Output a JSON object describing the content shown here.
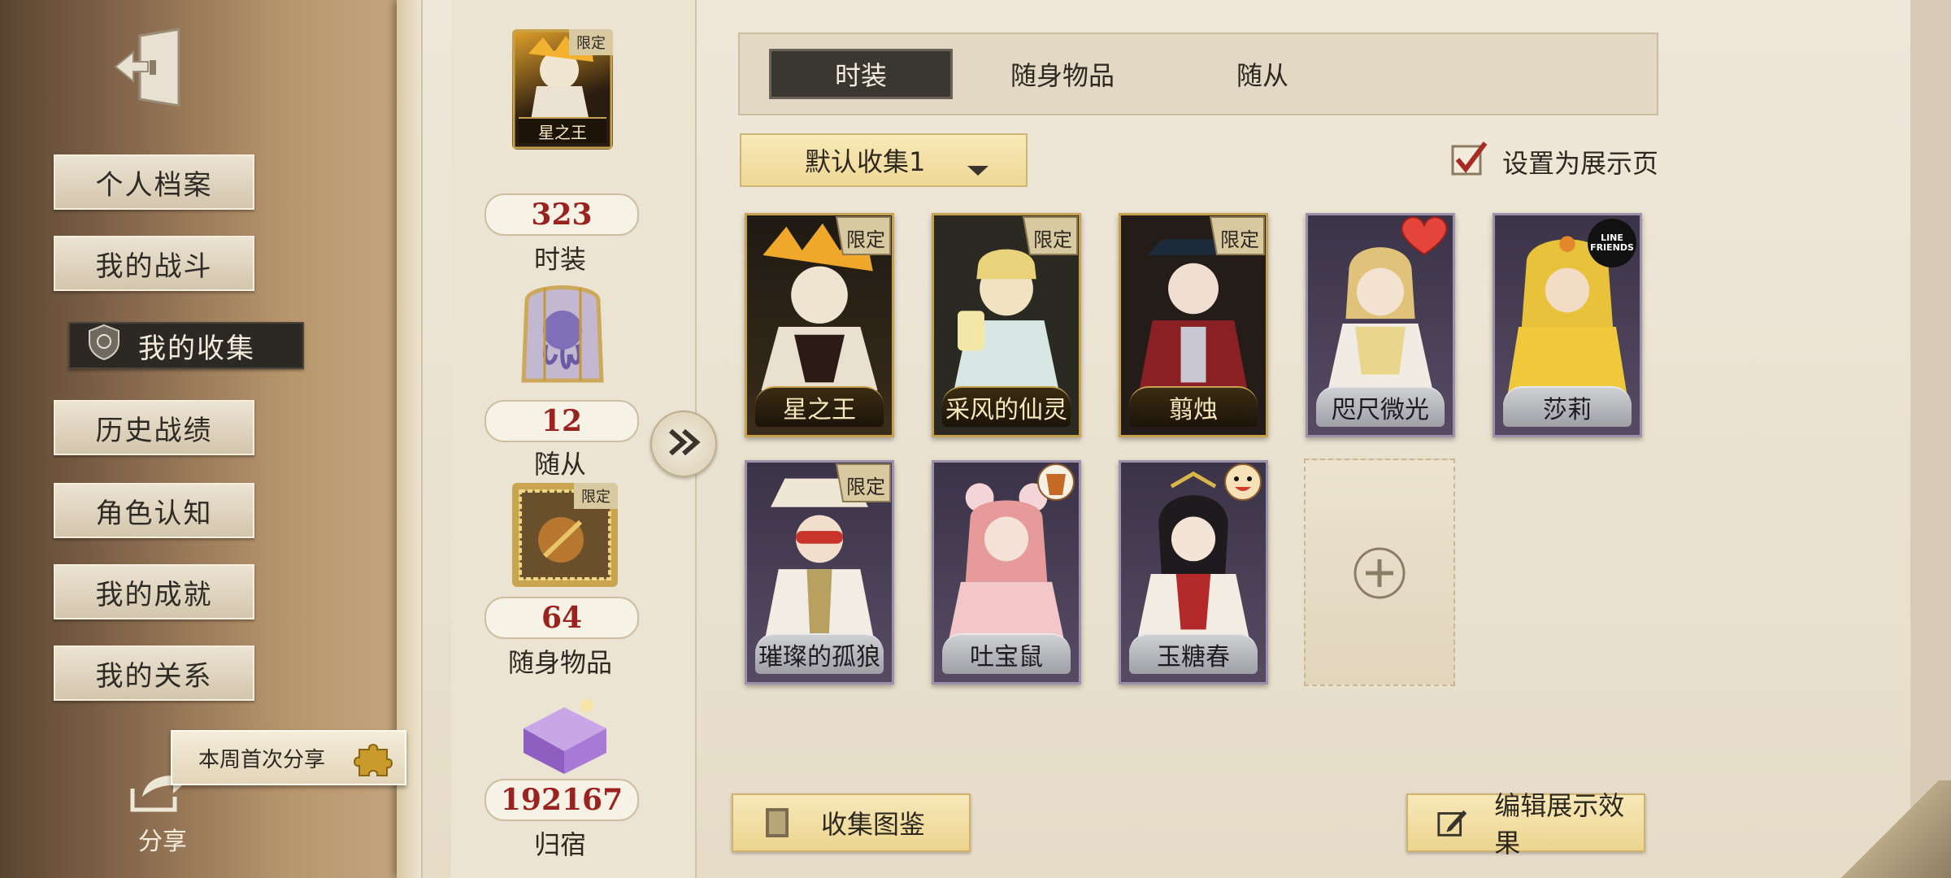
{
  "sidebar": {
    "items": [
      {
        "label": "个人档案"
      },
      {
        "label": "我的战斗"
      },
      {
        "label": "我的收集"
      },
      {
        "label": "历史战绩"
      },
      {
        "label": "角色认知"
      },
      {
        "label": "我的成就"
      },
      {
        "label": "我的关系"
      }
    ],
    "active_item": "我的收集",
    "share_banner": "本周首次分享",
    "share_label": "分享"
  },
  "summary": {
    "costume": {
      "thumb_label": "星之王",
      "badge": "限定",
      "count": "323",
      "label": "时装"
    },
    "pet": {
      "count": "12",
      "label": "随从"
    },
    "accessory": {
      "badge": "限定",
      "count": "64",
      "label": "随身物品"
    },
    "home": {
      "count": "192167",
      "label": "归宿"
    }
  },
  "tabs": [
    {
      "label": "时装",
      "active": true
    },
    {
      "label": "随身物品",
      "active": false
    },
    {
      "label": "随从",
      "active": false
    }
  ],
  "dropdown": {
    "selected": "默认收集1"
  },
  "showcase": {
    "label": "设置为展示页",
    "checked": true
  },
  "cards": [
    {
      "name": "星之王",
      "badge": "限定",
      "frame": "gold"
    },
    {
      "name": "采风的仙灵",
      "badge": "限定",
      "frame": "gold"
    },
    {
      "name": "翦烛",
      "badge": "限定",
      "frame": "gold"
    },
    {
      "name": "咫尺微光",
      "badge": "heart",
      "frame": "purple"
    },
    {
      "name": "莎莉",
      "badge": "LINE FRIENDS",
      "frame": "purple"
    },
    {
      "name": "璀璨的孤狼",
      "badge": "限定",
      "frame": "purple"
    },
    {
      "name": "吐宝鼠",
      "badge": "collab-cup",
      "frame": "purple"
    },
    {
      "name": "玉糖春",
      "badge": "collab-face",
      "frame": "purple"
    }
  ],
  "buttons": {
    "codex": "收集图鉴",
    "edit": "编辑展示效果"
  },
  "colors": {
    "count_red": "#9a2320",
    "tab_active": "#3a3630",
    "dropdown": "#efd896",
    "check": "#a82a22"
  }
}
